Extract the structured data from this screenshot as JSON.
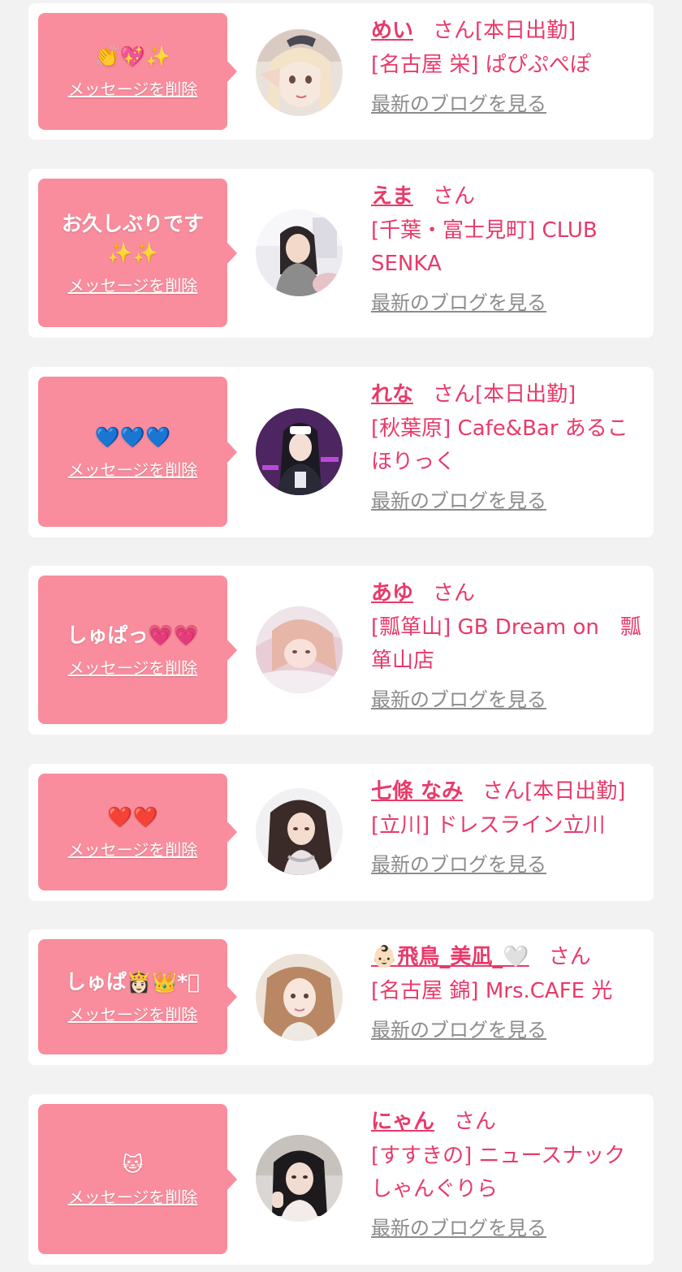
{
  "delete_label": "メッセージを削除",
  "blog_label": "最新のブログを見る",
  "honorific": "さん",
  "colors": {
    "bubble": "#f98d9d",
    "accent": "#e83a6a",
    "link_gray": "#8c8c8c",
    "background": "#f2f2f2"
  },
  "entries": [
    {
      "message": "👏💖✨",
      "name": "めい",
      "status": "[本日出勤]",
      "shop": "[名古屋 栄] ぱぴぷぺぽ",
      "avatar": "avatar-photo"
    },
    {
      "message": "お久しぶりです✨✨",
      "name": "えま",
      "status": "",
      "shop": "[千葉・富士見町] CLUB SENKA",
      "avatar": "avatar-photo"
    },
    {
      "message": "💙💙💙",
      "name": "れな",
      "status": "[本日出勤]",
      "shop": "[秋葉原] Cafe&Bar あるこほりっく",
      "avatar": "avatar-photo"
    },
    {
      "message": "しゅぱっ💗💗",
      "name": "あゆ",
      "status": "",
      "shop": "[瓢箪山] GB Dream on　瓢箪山店",
      "avatar": "avatar-photo"
    },
    {
      "message": "❤️❤️",
      "name": "七條 なみ",
      "status": "[本日出勤]",
      "shop": "[立川] ドレスライン立川",
      "avatar": "avatar-photo"
    },
    {
      "message": "しゅぱ👸🏻👑*ﾟ",
      "name": "👶🏻飛鳥_美凪_🤍",
      "status": "",
      "shop": "[名古屋 錦] Mrs.CAFE 光",
      "avatar": "avatar-photo"
    },
    {
      "message": "🐱",
      "name": "にゃん",
      "status": "",
      "shop": "[すすきの] ニュースナック しゃんぐりら",
      "avatar": "avatar-photo"
    }
  ]
}
